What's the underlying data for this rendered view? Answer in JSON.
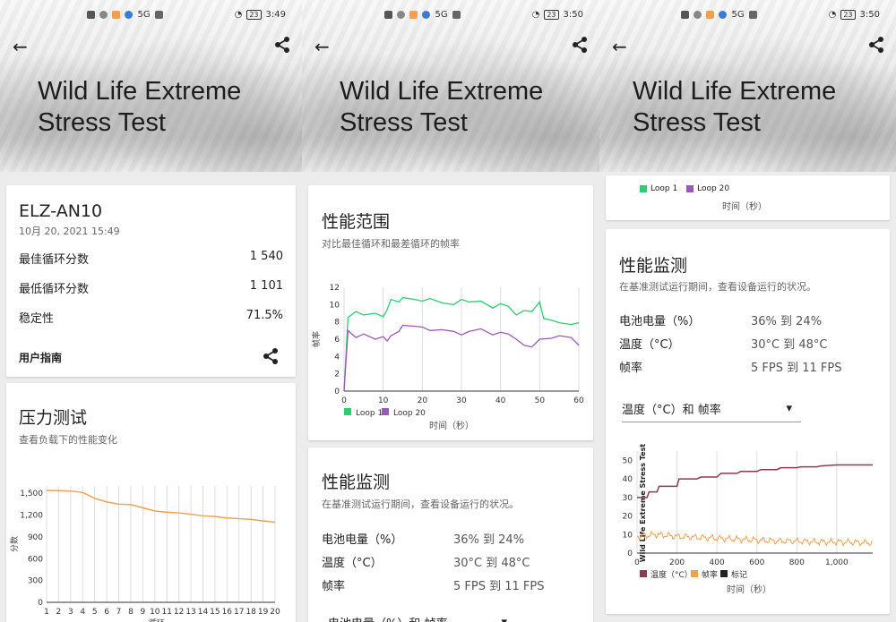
{
  "title_line1": "Wild Life Extreme",
  "title_line2": "Stress Test",
  "status_times": [
    "3:49",
    "3:50",
    "3:50"
  ],
  "status_network": "5G",
  "status_battery": "23",
  "device": {
    "name": "ELZ-AN10",
    "date": "10月 20, 2021 15:49",
    "best_label": "最佳循环分数",
    "best_value": "1 540",
    "worst_label": "最低循环分数",
    "worst_value": "1 101",
    "stability_label": "稳定性",
    "stability_value": "71.5%",
    "guide_label": "用户指南"
  },
  "stress": {
    "title": "压力测试",
    "subtitle": "查看负载下的性能变化",
    "ylabel": "分数",
    "xlabel": "循环"
  },
  "range": {
    "title": "性能范围",
    "subtitle": "对比最佳循环和最差循环的帧率",
    "ylabel": "帧率",
    "xlabel": "时间（秒）"
  },
  "monitor": {
    "title": "性能监测",
    "subtitle": "在基准测试运行期间，查看设备运行的状况。",
    "battery_label": "电池电量（%）",
    "battery_value": "36% 到 24%",
    "temp_label": "温度（°C）",
    "temp_value": "30°C 到 48°C",
    "fps_label": "帧率",
    "fps_value": "5 FPS 到 11 FPS",
    "dropdown_value": "温度（°C）和 帧率",
    "dropdown_partial": "电池电量（%）和 帧率",
    "chart_inner_label": "Wild Life Extreme Stress Test",
    "xlabel": "时间（秒）"
  },
  "legend": {
    "loop1": "Loop 1",
    "loop20": "Loop 20",
    "temp": "温度（°C）",
    "fps": "帧率",
    "mark": "标记"
  },
  "colors": {
    "orange": "#f0a050",
    "green": "#2ecc71",
    "purple": "#9b59b6",
    "maroon": "#8e3a4f",
    "accent_dark": "#222222"
  },
  "chart_data": [
    {
      "type": "line",
      "title": "压力测试",
      "xlabel": "循环",
      "ylabel": "分数",
      "categories": [
        "1",
        "2",
        "3",
        "4",
        "5",
        "6",
        "7",
        "8",
        "9",
        "10",
        "11",
        "12",
        "13",
        "14",
        "15",
        "16",
        "17",
        "18",
        "19",
        "20"
      ],
      "x_ticks": [
        "1",
        "2",
        "3",
        "4",
        "5",
        "6",
        "7",
        "8",
        "9",
        "10",
        "11",
        "12",
        "13",
        "14",
        "15",
        "16",
        "17",
        "18",
        "19",
        "20"
      ],
      "y_ticks": [
        "0",
        "300",
        "600",
        "900",
        "1,200",
        "1,500"
      ],
      "ylim": [
        0,
        1600
      ],
      "series": [
        {
          "values": [
            1540,
            1535,
            1530,
            1510,
            1430,
            1380,
            1350,
            1345,
            1300,
            1255,
            1240,
            1230,
            1210,
            1190,
            1180,
            1160,
            1150,
            1140,
            1120,
            1101
          ]
        }
      ]
    },
    {
      "type": "line",
      "title": "性能范围",
      "xlabel": "时间（秒）",
      "ylabel": "帧率",
      "x_ticks": [
        "0",
        "10",
        "20",
        "30",
        "40",
        "50",
        "60"
      ],
      "y_ticks": [
        "0",
        "2",
        "4",
        "6",
        "8",
        "10",
        "12"
      ],
      "xlim": [
        0,
        60
      ],
      "ylim": [
        0,
        12
      ],
      "series": [
        {
          "name": "Loop 1",
          "x": [
            0,
            1,
            3,
            5,
            8,
            10,
            11,
            12,
            14,
            15,
            18,
            20,
            22,
            25,
            28,
            30,
            32,
            35,
            38,
            40,
            42,
            44,
            46,
            48,
            50,
            51,
            53,
            55,
            58,
            60
          ],
          "y": [
            0,
            8.5,
            9.2,
            8.8,
            9.0,
            8.6,
            9.4,
            10.6,
            10.3,
            10.8,
            10.6,
            10.4,
            10.7,
            10.2,
            10.0,
            10.6,
            10.3,
            10.4,
            9.6,
            10.1,
            9.8,
            8.8,
            9.3,
            9.2,
            10.3,
            8.4,
            8.2,
            7.9,
            7.7,
            7.9
          ]
        },
        {
          "name": "Loop 20",
          "x": [
            0,
            1,
            3,
            5,
            8,
            10,
            11,
            12,
            14,
            15,
            18,
            20,
            22,
            25,
            28,
            30,
            32,
            35,
            38,
            40,
            42,
            44,
            46,
            48,
            50,
            53,
            55,
            58,
            60
          ],
          "y": [
            0,
            7.0,
            6.2,
            6.6,
            6.0,
            6.3,
            5.8,
            6.4,
            6.9,
            7.6,
            7.5,
            7.4,
            7.0,
            7.1,
            6.9,
            6.5,
            6.9,
            7.2,
            6.5,
            6.8,
            6.6,
            6.0,
            5.3,
            5.1,
            6.0,
            6.1,
            6.4,
            6.2,
            5.3
          ]
        }
      ]
    },
    {
      "type": "line",
      "title": "Wild Life Extreme Stress Test",
      "xlabel": "时间（秒）",
      "x_ticks": [
        "0",
        "200",
        "400",
        "600",
        "800",
        "1,000"
      ],
      "y_ticks": [
        "0",
        "10",
        "20",
        "30",
        "40",
        "50"
      ],
      "xlim": [
        0,
        1180
      ],
      "ylim": [
        0,
        55
      ],
      "series": [
        {
          "name": "温度（°C）",
          "x": [
            0,
            50,
            60,
            100,
            110,
            200,
            210,
            300,
            320,
            400,
            420,
            500,
            520,
            600,
            620,
            700,
            720,
            800,
            820,
            900,
            920,
            1000,
            1100,
            1180
          ],
          "y": [
            30,
            30,
            33,
            33,
            36,
            36,
            40,
            40,
            41,
            41,
            43,
            43,
            44,
            44,
            45,
            45,
            46,
            46,
            46.5,
            46.5,
            47,
            47.5,
            47.5,
            47.5
          ]
        },
        {
          "name": "帧率",
          "x": [
            0,
            100,
            200,
            300,
            400,
            500,
            600,
            700,
            800,
            900,
            1000,
            1100,
            1180
          ],
          "y": [
            9,
            10,
            9,
            8.5,
            8,
            7.5,
            7,
            6.5,
            6.5,
            6,
            6,
            5.8,
            5.5
          ]
        },
        {
          "name": "标记",
          "x": [],
          "y": []
        }
      ]
    }
  ]
}
